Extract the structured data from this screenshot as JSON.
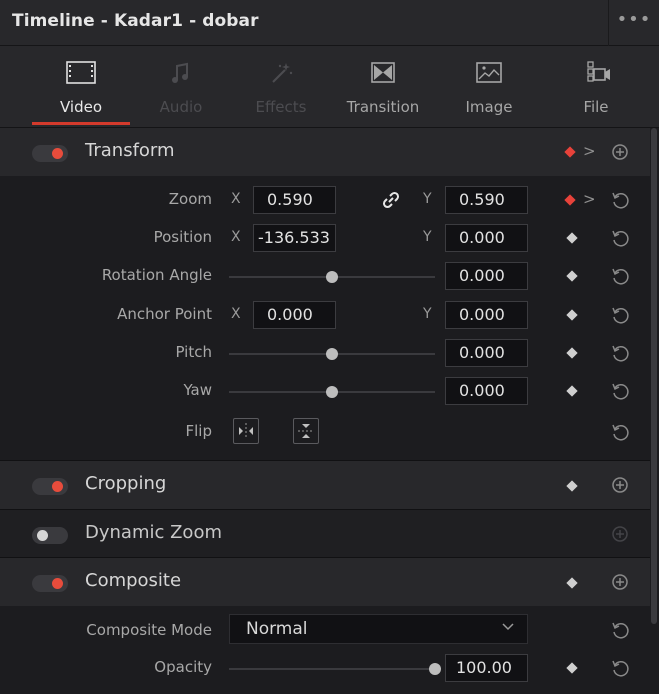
{
  "window": {
    "title": "Timeline - Kadar1 - dobar",
    "menu_glyph": "•••"
  },
  "tabs": [
    {
      "label": "Video",
      "icon": "film-frame-icon",
      "state": "active"
    },
    {
      "label": "Audio",
      "icon": "music-note-icon",
      "state": "disabled"
    },
    {
      "label": "Effects",
      "icon": "magic-wand-icon",
      "state": "disabled"
    },
    {
      "label": "Transition",
      "icon": "bowtie-transition-icon",
      "state": "normal"
    },
    {
      "label": "Image",
      "icon": "image-icon",
      "state": "normal"
    },
    {
      "label": "File",
      "icon": "film-camera-icon",
      "state": "normal"
    }
  ],
  "transform": {
    "title": "Transform",
    "enabled": true,
    "zoom": {
      "label": "Zoom",
      "x_axis": "X",
      "x": "0.590",
      "y_axis": "Y",
      "y": "0.590",
      "linked": true
    },
    "position": {
      "label": "Position",
      "x_axis": "X",
      "x": "-136.533",
      "y_axis": "Y",
      "y": "0.000"
    },
    "rotation": {
      "label": "Rotation Angle",
      "value": "0.000",
      "slider": 0.5
    },
    "anchor": {
      "label": "Anchor Point",
      "x_axis": "X",
      "x": "0.000",
      "y_axis": "Y",
      "y": "0.000"
    },
    "pitch": {
      "label": "Pitch",
      "value": "0.000",
      "slider": 0.5
    },
    "yaw": {
      "label": "Yaw",
      "value": "0.000",
      "slider": 0.5
    },
    "flip": {
      "label": "Flip"
    }
  },
  "cropping": {
    "title": "Cropping",
    "enabled": true
  },
  "dynamic_zoom": {
    "title": "Dynamic Zoom",
    "enabled": false
  },
  "composite": {
    "title": "Composite",
    "enabled": true,
    "mode": {
      "label": "Composite Mode",
      "value": "Normal"
    },
    "opacity": {
      "label": "Opacity",
      "value": "100.00",
      "slider": 1.0
    }
  },
  "colors": {
    "accent": "#d33a2c",
    "keyframe_active": "#e7423a",
    "toggle_on": "#e74c3c"
  }
}
